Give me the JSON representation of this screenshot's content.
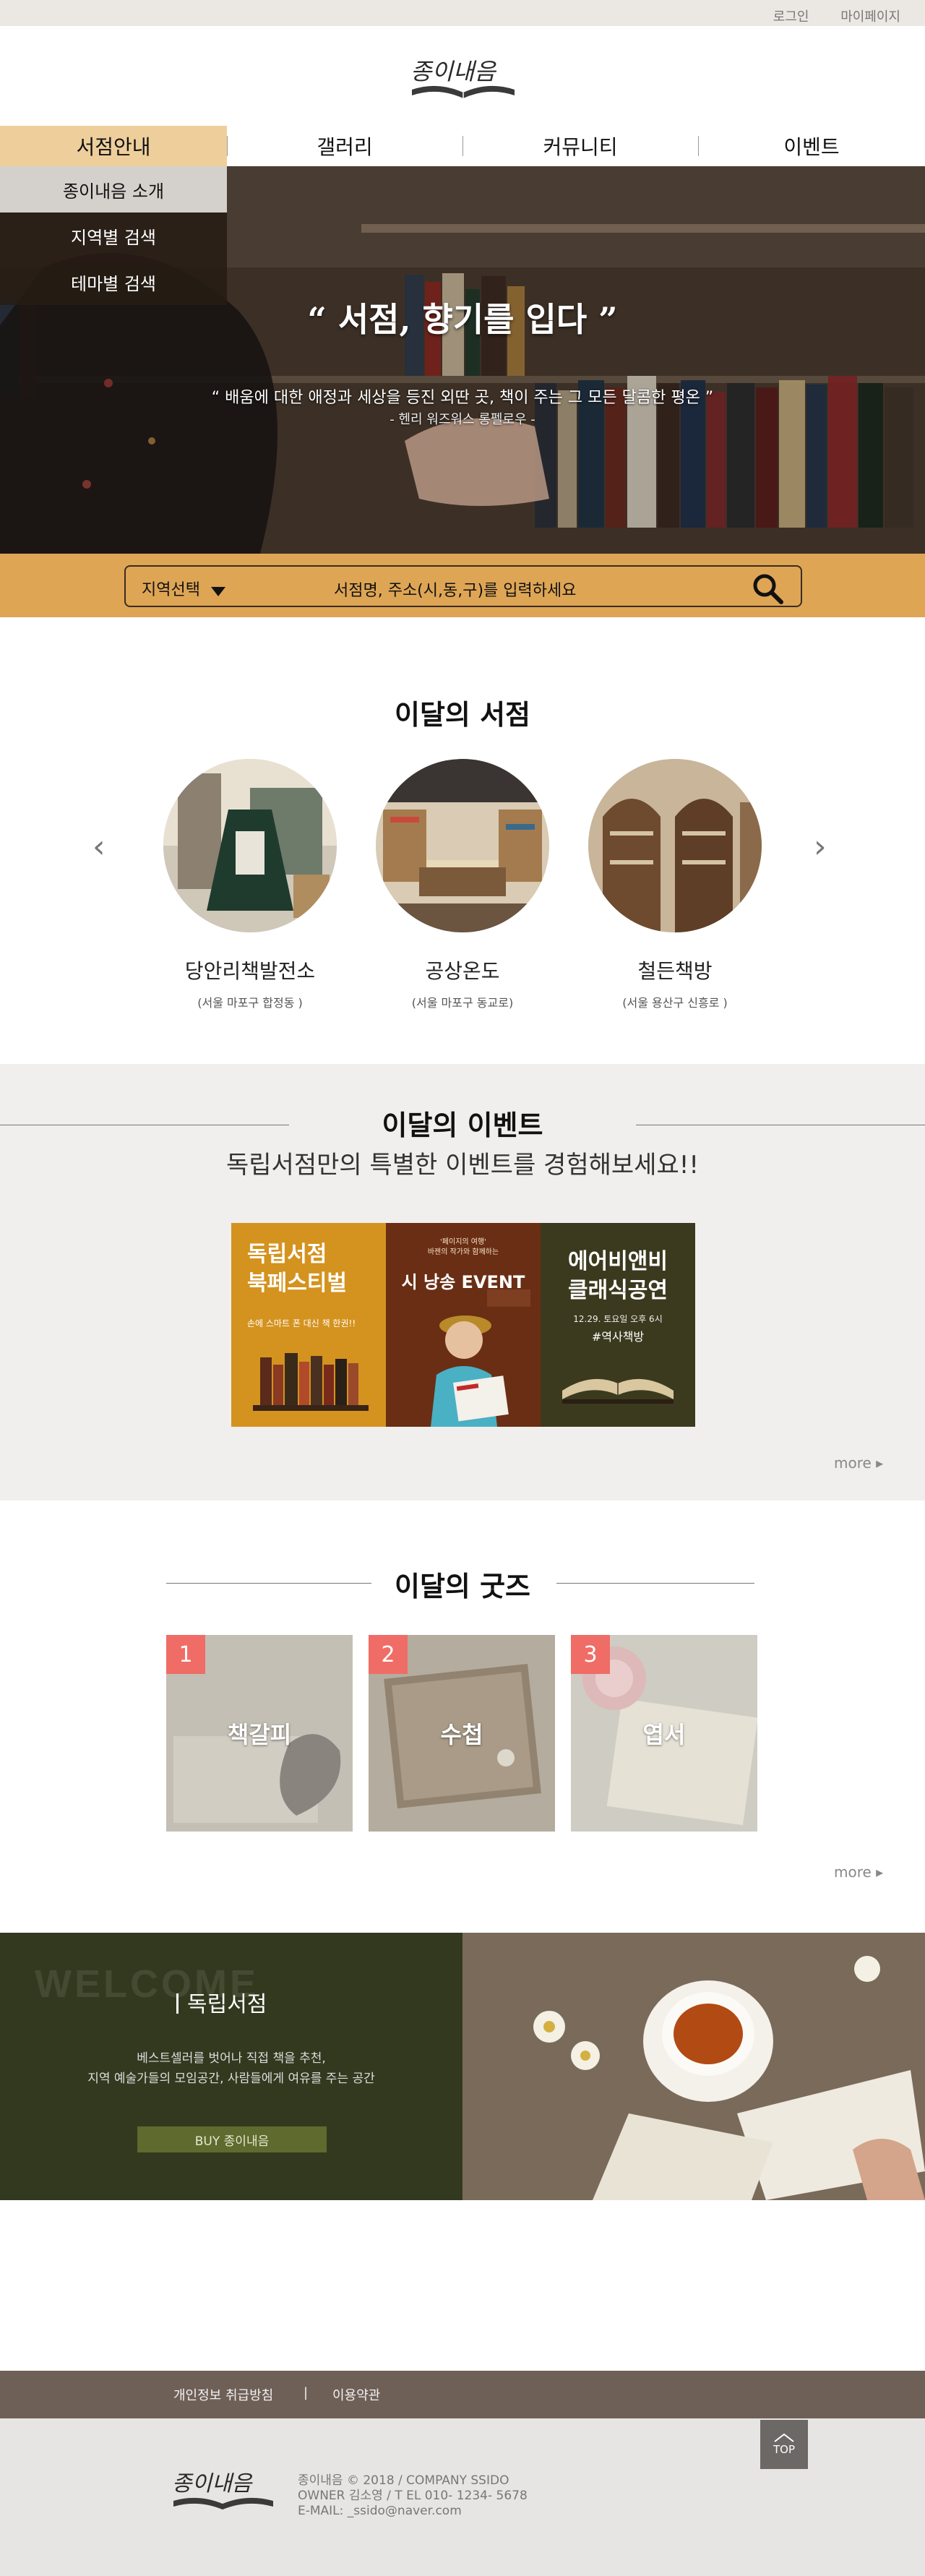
{
  "topbar": {
    "login": "로그인",
    "mypage": "마이페이지"
  },
  "logo": {
    "text": "종이내음"
  },
  "nav": [
    {
      "label": "서점안내"
    },
    {
      "label": "갤러리"
    },
    {
      "label": "커뮤니티"
    },
    {
      "label": "이벤트"
    }
  ],
  "dropdown": [
    "종이내음 소개",
    "지역별 검색",
    "테마별 검색"
  ],
  "hero": {
    "quote": "“ 서점, 향기를 입다 ”",
    "sub": "“ 배움에 대한 애정과 세상을 등진 외딴 곳, 책이 주는 그 모든 달콤한 평온 ”",
    "author": "- 헨리 워즈워스 롱펠로우 -"
  },
  "search": {
    "region": "지역선택",
    "placeholder": "서점명, 주소(시,동,구)를 입력하세요"
  },
  "stores": {
    "title": "이달의 서점",
    "items": [
      {
        "name": "당안리책발전소",
        "addr": "(서울 마포구 합정동 )"
      },
      {
        "name": "공상온도",
        "addr": "(서울 마포구 동교로)"
      },
      {
        "name": "철든책방",
        "addr": "(서울 용산구 신흥로 )"
      }
    ]
  },
  "events": {
    "title": "이달의 이벤트",
    "subtitle": "독립서점만의 특별한 이벤트를 경험해보세요!!",
    "banners": [
      {
        "title1": "독립서점",
        "title2": "북페스티벌",
        "desc": "손에 스마트 폰 대신 책 한권!!"
      },
      {
        "small1": "'페이지의 여행'",
        "small2": "바젠의 작가와 함께하는",
        "title": "시 낭송  EVENT"
      },
      {
        "title1": "에어비앤비",
        "title2": "클래식공연",
        "date": "12.29. 토요일 오후 6시",
        "place": "#역사책방"
      }
    ],
    "more": "more ▸"
  },
  "goods": {
    "title": "이달의 굿즈",
    "items": [
      {
        "num": "1",
        "label": "책갈피"
      },
      {
        "num": "2",
        "label": "수첩"
      },
      {
        "num": "3",
        "label": "엽서"
      }
    ],
    "more": "more ▸"
  },
  "welcome": {
    "bg": "WELCOME",
    "title": "독립서점",
    "line1": "베스트셀러를 벗어나 직접 책을 추천,",
    "line2": "지역 예술가들의 모임공간,  사람들에게 여유를 주는 공간",
    "buy": "BUY 종이내음"
  },
  "footer": {
    "privacy": "개인정보 취급방침",
    "divider": "|",
    "terms": "이용약관",
    "top": "TOP",
    "line1": "종이내음 © 2018   /   COMPANY  SSIDO",
    "line2": "OWNER  김소영   /  T EL  010- 1234- 5678",
    "line3": "E-MAIL: _ssido@naver.com"
  },
  "colors": {
    "accent": "#dea555",
    "nav_active": "#eecf9c",
    "badge": "#ef6d66",
    "welcome": "#33391f",
    "footer": "#6f6057"
  }
}
